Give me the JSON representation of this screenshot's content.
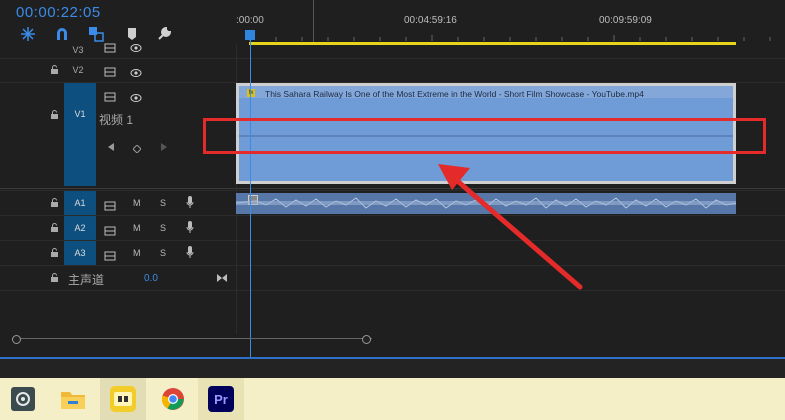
{
  "header": {
    "timecode": "00:00:22:05"
  },
  "ruler": {
    "labels": [
      ":00:00",
      "00:04:59:16",
      "00:09:59:09"
    ]
  },
  "tracks": {
    "video": [
      {
        "name": "V3"
      },
      {
        "name": "V2"
      },
      {
        "name": "V1",
        "label": "视频 1"
      }
    ],
    "audio": [
      {
        "name": "A1",
        "mute": "M",
        "solo": "S"
      },
      {
        "name": "A2",
        "mute": "M",
        "solo": "S"
      },
      {
        "name": "A3",
        "mute": "M",
        "solo": "S"
      }
    ],
    "master": {
      "label": "主声道",
      "value": "0.0"
    }
  },
  "clip": {
    "video_title": "This Sahara Railway Is One of the Most Extreme in the World - Short Film Showcase - YouTube.mp4",
    "fx_badge": "fx"
  },
  "taskbar": {
    "apps": [
      {
        "icon": "settings-app-icon"
      },
      {
        "icon": "file-explorer-icon"
      },
      {
        "icon": "yellow-app-icon"
      },
      {
        "icon": "chrome-icon"
      },
      {
        "icon": "premiere-pro-icon",
        "label": "Pr"
      }
    ]
  },
  "colors": {
    "accent": "#3b8be8",
    "selected_track": "#0d4f7e",
    "clip": "#6f9bd6",
    "annotation": "#e52a2a",
    "workarea": "#e6d41b"
  }
}
